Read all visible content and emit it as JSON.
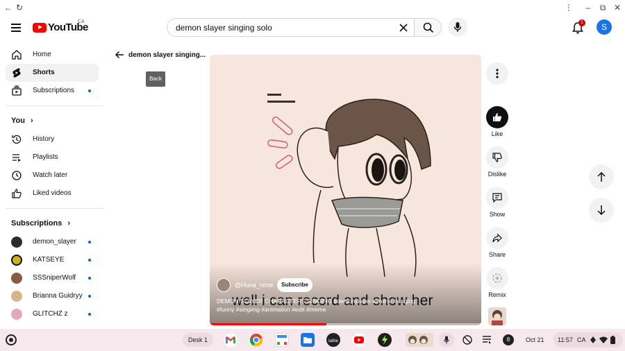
{
  "window": {
    "controls": {
      "menu": "⋮",
      "minimize": "–",
      "maximize": "⧉",
      "close": "✕"
    }
  },
  "masthead": {
    "logo_text": "YouTube",
    "region": "CA",
    "search_value": "demon slayer singing solo",
    "notification_count": "1",
    "account_initial": "S"
  },
  "sidebar": {
    "main": [
      {
        "label": "Home",
        "icon": "home-icon"
      },
      {
        "label": "Shorts",
        "icon": "shorts-icon",
        "active": true
      },
      {
        "label": "Subscriptions",
        "icon": "subscriptions-icon",
        "dot": true
      }
    ],
    "you_header": "You",
    "you_items": [
      {
        "label": "History",
        "icon": "history-icon"
      },
      {
        "label": "Playlists",
        "icon": "playlists-icon"
      },
      {
        "label": "Watch later",
        "icon": "clock-icon"
      },
      {
        "label": "Liked videos",
        "icon": "thumbs-up-icon"
      }
    ],
    "subs_header": "Subscriptions",
    "subscriptions": [
      {
        "label": "demon_slayer",
        "color": "#2b2b2b"
      },
      {
        "label": "KATSEYE",
        "color": "#c9b21b"
      },
      {
        "label": "SSSniperWolf",
        "color": "#8a5a44"
      },
      {
        "label": "Brianna Guidryy",
        "color": "#d8b487"
      },
      {
        "label": "GLITCHZ z",
        "color": "#e6a8b8"
      }
    ]
  },
  "shorts": {
    "back_title": "demon slayer singing...",
    "back_tooltip": "Back",
    "channel": "@Huna_nime",
    "subscribe": "Subscribe",
    "title_line1": "DEMON SLAYER CHARACTERS SINGING #demonslayer #anime #singing",
    "title_line2": "#funny #singimg #animation #edit #meme",
    "caption": "well i can record and show her",
    "progress": 0.43,
    "actions": {
      "like": "Like",
      "dislike": "Dislike",
      "show": "Show",
      "share": "Share",
      "remix": "Remix"
    }
  },
  "shelf": {
    "desk": "Desk 1",
    "apps": [
      {
        "name": "gmail-icon",
        "color": "#ffffff"
      },
      {
        "name": "chrome-icon",
        "color": "#fbbc04"
      },
      {
        "name": "calendar-icon",
        "color": "#ffffff"
      },
      {
        "name": "files-icon",
        "color": "#1a73e8"
      },
      {
        "name": "talkie-icon",
        "color": "#202124"
      },
      {
        "name": "youtube-icon",
        "color": "#ff0000"
      },
      {
        "name": "game-icon",
        "color": "#1e1e1e"
      }
    ],
    "date": "Oct 21",
    "time": "11:57",
    "locale": "CA",
    "notification_count": "8"
  }
}
